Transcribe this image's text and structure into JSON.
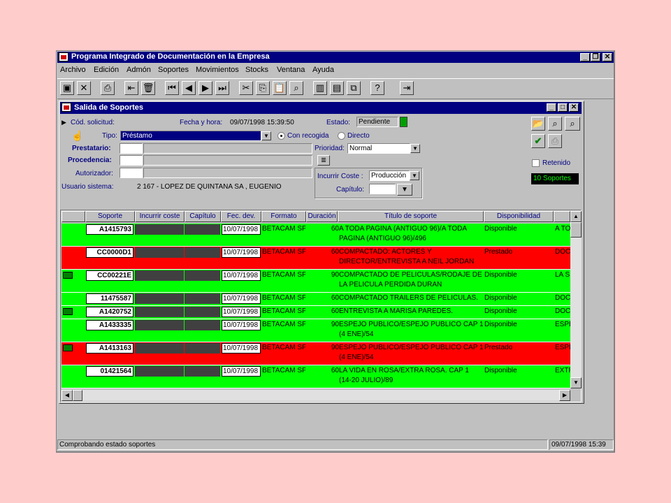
{
  "app": {
    "title": "Programa Integrado de Documentación en la Empresa"
  },
  "menu": [
    "Archivo",
    "Edición",
    "Admón",
    "Soportes",
    "Movimientos",
    "Stocks",
    "Ventana",
    "Ayuda"
  ],
  "child": {
    "title": "Salida de Soportes"
  },
  "form": {
    "cod_label": "Cód. solicitud:",
    "fecha_label": "Fecha y hora:",
    "fecha_value": "09/07/1998 15:39:50",
    "estado_label": "Estado:",
    "estado_value": "Pendiente",
    "tipo_label": "Tipo:",
    "tipo_value": "Préstamo",
    "con_recogida": "Con recogida",
    "directo": "Directo",
    "prestatario_label": "Prestatario:",
    "procedencia_label": "Procedencia:",
    "autorizador_label": "Autorizador:",
    "prioridad_label": "Prioridad:",
    "prioridad_value": "Normal",
    "incurrir_label": "Incurrir Coste :",
    "incurrir_value": "Producción",
    "capitulo_label": "Capítulo:",
    "usuario_label": "Usuario sistema:",
    "usuario_value": "2 167 - LOPEZ DE QUINTANA SA  , EUGENIO",
    "retenido_label": "Retenido",
    "soportes_badge": "10 Soportes"
  },
  "grid": {
    "headers": [
      "Soporte",
      "Incurrir coste",
      "Capítulo",
      "Fec. dev.",
      "Formato",
      "Duración",
      "Título de soporte",
      "Disponibilidad"
    ],
    "rows": [
      {
        "soporte": "A1415793",
        "fec": "10/07/1998",
        "formato": "BETACAM SP",
        "dur": "60",
        "titulo1": "A TODA PAGINA (ANTIGUO 96)/A TODA",
        "titulo2": "PAGINA (ANTIGUO 96)/496",
        "disp": "Disponible",
        "extra": "A TO",
        "color": "green",
        "icon": false
      },
      {
        "soporte": "CC0000D1",
        "fec": "10/07/1998",
        "formato": "BETACAM SP",
        "dur": "60",
        "titulo1": "COMPACTADO: ACTORES Y",
        "titulo2": "DIRECTOR/ENTREVISTA A NEIL JORDAN",
        "disp": "Prestado",
        "extra": "DOC",
        "color": "red",
        "icon": false
      },
      {
        "soporte": "CC00221E",
        "fec": "10/07/1998",
        "formato": "BETACAM SP",
        "dur": "90",
        "titulo1": "COMPACTADO DE PELICULAS/RODAJE DE",
        "titulo2": "LA PELICULA PERDIDA DURAN",
        "disp": "Disponible",
        "extra": "LA S",
        "color": "green",
        "icon": true
      },
      {
        "soporte": "11475587",
        "fec": "10/07/1998",
        "formato": "BETACAM SP",
        "dur": "60",
        "titulo1": "COMPACTADO TRAILERS DE PELICULAS.",
        "titulo2": "",
        "disp": "Disponible",
        "extra": "DOC",
        "color": "green",
        "icon": false
      },
      {
        "soporte": "A1420752",
        "fec": "10/07/1998",
        "formato": "BETACAM SP",
        "dur": "60",
        "titulo1": "ENTREVISTA A MARISA PAREDES.",
        "titulo2": "",
        "disp": "Disponible",
        "extra": "DOC",
        "color": "green",
        "icon": true
      },
      {
        "soporte": "A1433335",
        "fec": "10/07/1998",
        "formato": "BETACAM SP",
        "dur": "90",
        "titulo1": "ESPEJO PUBLICO/ESPEJO PUBLICO CAP 1",
        "titulo2": "(4 ENE)/54",
        "disp": "Disponible",
        "extra": "ESPE",
        "color": "green",
        "icon": false
      },
      {
        "soporte": "A1413163",
        "fec": "10/07/1998",
        "formato": "BETACAM SP",
        "dur": "90",
        "titulo1": "ESPEJO PUBLICO/ESPEJO PUBLICO CAP 1",
        "titulo2": "(4 ENE)/54",
        "disp": "Prestado",
        "extra": "ESPE",
        "color": "red",
        "icon": true
      },
      {
        "soporte": "01421564",
        "fec": "10/07/1998",
        "formato": "BETACAM SP",
        "dur": "60",
        "titulo1": "LA VIDA EN ROSA/EXTRA ROSA. CAP 1",
        "titulo2": "(14-20 JULIO)/89",
        "disp": "Disponible",
        "extra": "EXTR",
        "color": "green",
        "icon": false
      }
    ]
  },
  "status": {
    "message": "Comprobando estado soportes",
    "datetime": "09/07/1998 15:39"
  },
  "colors": {
    "green": "#00ff00",
    "red": "#ff0000",
    "title": "#000080",
    "background": "#ffcccc"
  }
}
